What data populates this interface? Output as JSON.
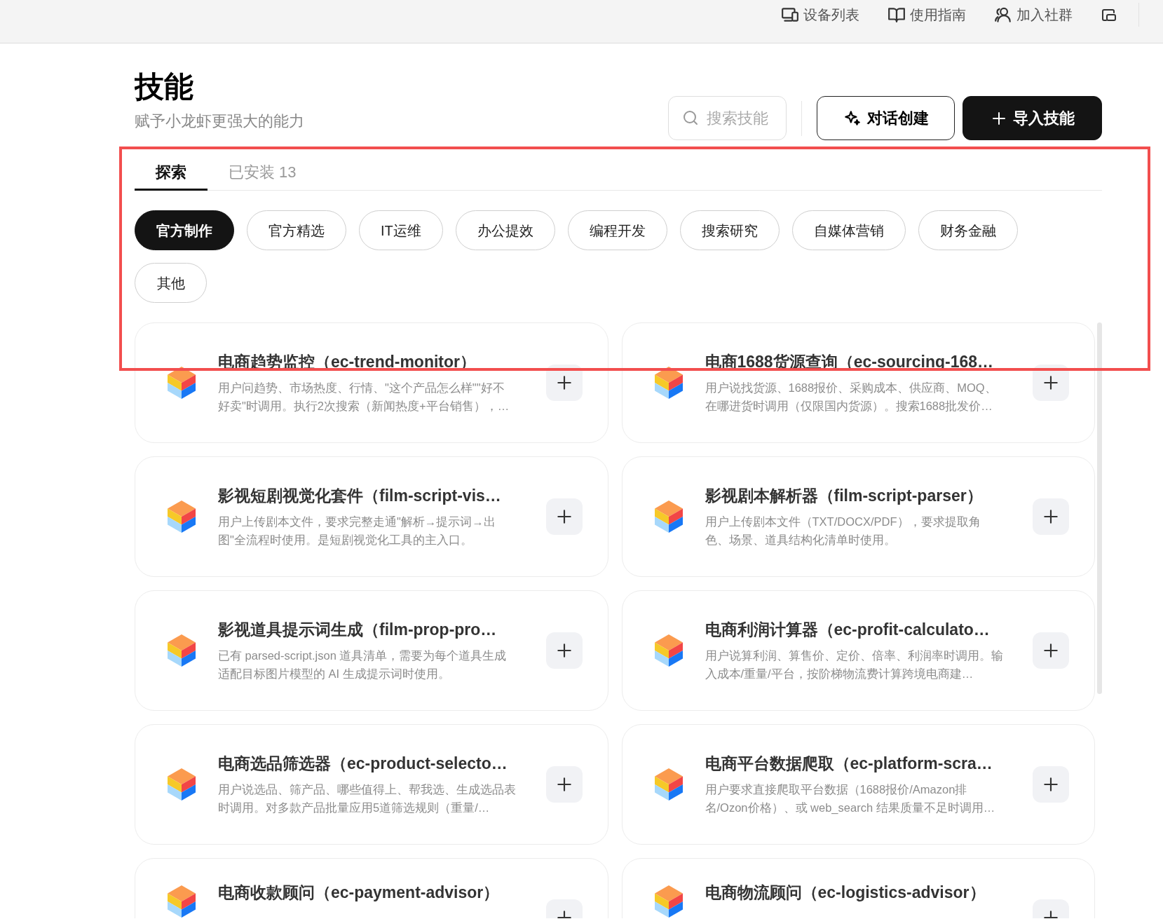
{
  "top_bar": {
    "items": [
      {
        "kind": "devices",
        "label": "设备列表"
      },
      {
        "kind": "guide",
        "label": "使用指南"
      },
      {
        "kind": "community",
        "label": "加入社群"
      },
      {
        "kind": "window"
      }
    ]
  },
  "header": {
    "title": "技能",
    "subtitle": "赋予小龙虾更强大的能力",
    "search": {
      "placeholder": "搜索技能"
    },
    "buttons": [
      {
        "kind": "outline",
        "label": "对话创建"
      },
      {
        "kind": "primary",
        "label": "导入技能"
      }
    ]
  },
  "tabs": [
    {
      "label": "探索",
      "selected": true
    },
    {
      "label": "已安装 13",
      "selected": false
    }
  ],
  "categories": [
    {
      "label": "官方制作",
      "selected": true
    },
    {
      "label": "官方精选",
      "selected": false
    },
    {
      "label": "IT运维",
      "selected": false
    },
    {
      "label": "办公提效",
      "selected": false
    },
    {
      "label": "编程开发",
      "selected": false
    },
    {
      "label": "搜索研究",
      "selected": false
    },
    {
      "label": "自媒体营销",
      "selected": false
    },
    {
      "label": "财务金融",
      "selected": false
    },
    {
      "label": "其他",
      "selected": false
    }
  ],
  "skills": [
    {
      "title": "电商趋势监控（ec-trend-monitor）",
      "description": "用户问趋势、市场热度、行情、\"这个产品怎么样\"\"好不好卖\"时调用。执行2次搜索（新闻热度+平台销售），…"
    },
    {
      "title": "电商1688货源查询（ec-sourcing-168…",
      "description": "用户说找货源、1688报价、采购成本、供应商、MOQ、在哪进货时调用（仅限国内货源）。搜索1688批发价…"
    },
    {
      "title": "影视短剧视觉化套件（film-script-vis…",
      "description": "用户上传剧本文件，要求完整走通\"解析→提示词→出图\"全流程时使用。是短剧视觉化工具的主入口。"
    },
    {
      "title": "影视剧本解析器（film-script-parser）",
      "description": "用户上传剧本文件（TXT/DOCX/PDF），要求提取角色、场景、道具结构化清单时使用。"
    },
    {
      "title": "影视道具提示词生成（film-prop-pro…",
      "description": "已有 parsed-script.json 道具清单，需要为每个道具生成适配目标图片模型的 AI 生成提示词时使用。"
    },
    {
      "title": "电商利润计算器（ec-profit-calculato…",
      "description": "用户说算利润、算售价、定价、倍率、利润率时调用。输入成本/重量/平台，按阶梯物流费计算跨境电商建…"
    },
    {
      "title": "电商选品筛选器（ec-product-selecto…",
      "description": "用户说选品、筛产品、哪些值得上、帮我选、生成选品表时调用。对多款产品批量应用5道筛选规则（重量/…"
    },
    {
      "title": "电商平台数据爬取（ec-platform-scra…",
      "description": "用户要求直接爬取平台数据（1688报价/Amazon排名/Ozon价格）、或 web_search 结果质量不足时调用…"
    },
    {
      "title": "电商收款顾问（ec-payment-advisor）"
    },
    {
      "title": "电商物流顾问（ec-logistics-advisor）"
    }
  ]
}
